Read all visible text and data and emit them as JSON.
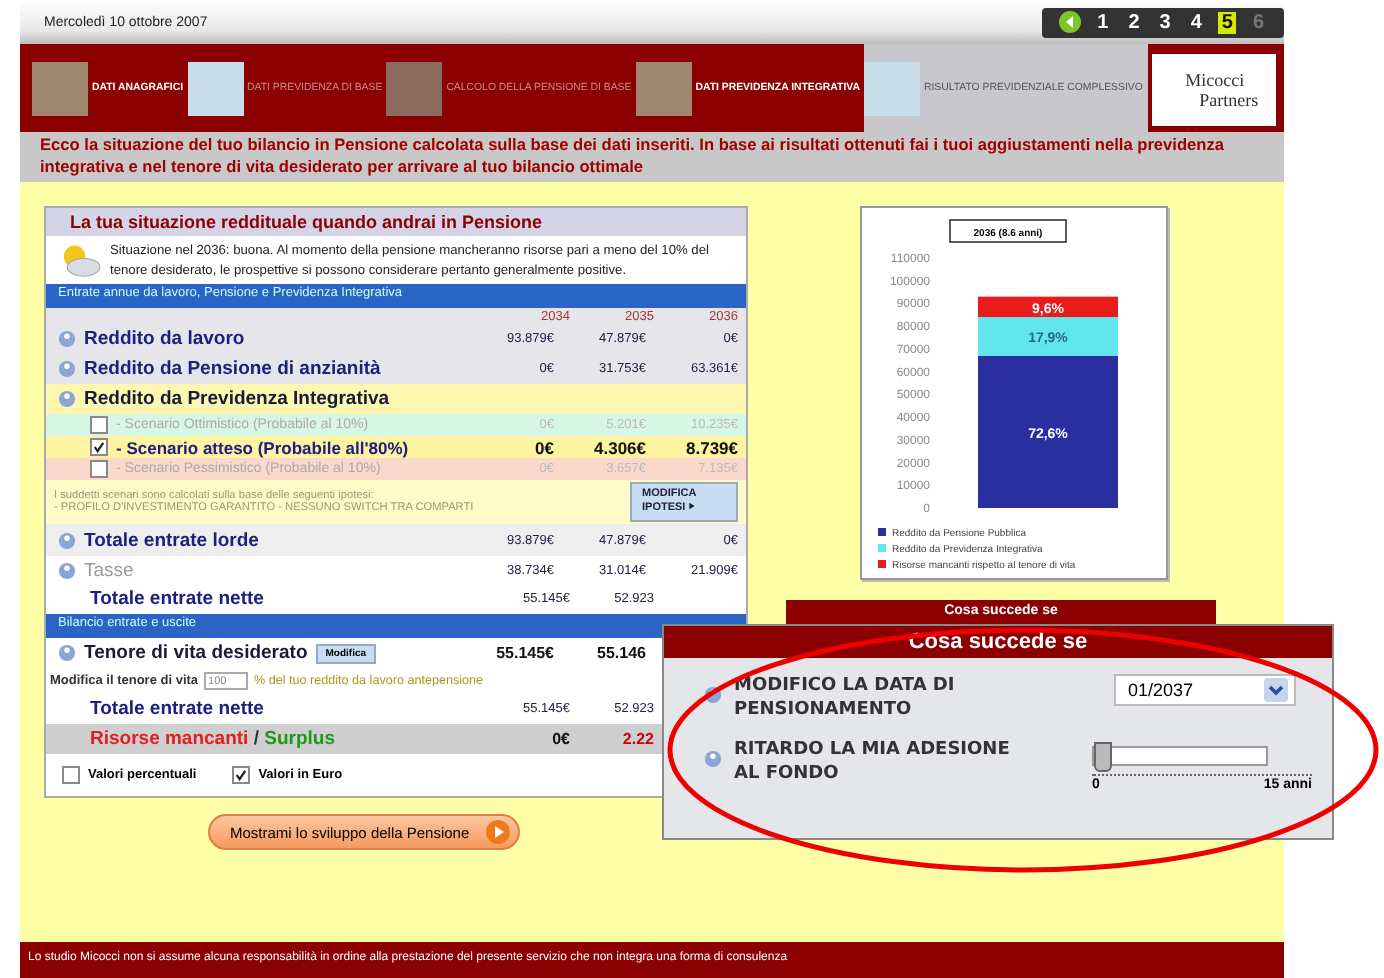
{
  "header": {
    "date": "Mercoledì 10 ottobre 2007",
    "steps": [
      {
        "label": "1",
        "selected": false,
        "disabled": false
      },
      {
        "label": "2",
        "selected": false,
        "disabled": false
      },
      {
        "label": "3",
        "selected": false,
        "disabled": false
      },
      {
        "label": "4",
        "selected": false,
        "disabled": false
      },
      {
        "label": "5",
        "selected": true,
        "disabled": false
      },
      {
        "label": "6",
        "selected": false,
        "disabled": true
      }
    ]
  },
  "tabs": [
    {
      "label": "DATI ANAGRAFICI",
      "selected": false,
      "disabled": false
    },
    {
      "label": "DATI PREVIDENZA DI BASE",
      "selected": false,
      "disabled": true
    },
    {
      "label": "CALCOLO DELLA PENSIONE DI BASE",
      "selected": false,
      "disabled": true
    },
    {
      "label": "DATI PREVIDENZA INTEGRATIVA",
      "selected": false,
      "disabled": false
    },
    {
      "label": "RISULTATO PREVIDENZIALE COMPLESSIVO",
      "selected": true,
      "disabled": false
    }
  ],
  "logo": {
    "line1": "Micocci",
    "line2": "Partners"
  },
  "intro": "Ecco la situazione del tuo bilancio in Pensione calcolata sulla base dei dati inseriti. In base ai risultati ottenuti fai i tuoi aggiustamenti nella previdenza integrativa e nel tenore di vita desiderato per arrivare al tuo bilancio ottimale",
  "panel": {
    "title": "La tua situazione reddituale quando andrai in Pensione",
    "summary": "Situazione nel 2036: buona. Al momento della pensione mancheranno risorse pari a meno del 10% del tenore desiderato, le prospettive si possono considerare pertanto generalmente positive.",
    "section": "Entrate annue da lavoro, Pensione e Previdenza Integrativa",
    "years": [
      "2034",
      "2035",
      "2036"
    ],
    "rows": [
      {
        "kind": "income",
        "label": "Reddito da lavoro",
        "values": [
          "93.879€",
          "47.879€",
          "0€"
        ]
      },
      {
        "kind": "income",
        "label": "Reddito da Pensione di anzianità",
        "values": [
          "0€",
          "31.753€",
          "63.361€"
        ]
      },
      {
        "kind": "group",
        "label": "Reddito da Previdenza Integrativa"
      },
      {
        "kind": "scenario",
        "label": "- Scenario Ottimistico (Probabile al 10%)",
        "checked": false,
        "color": "#d6f7e6",
        "values": [
          "0€",
          "5.201€",
          "10.235€"
        ]
      },
      {
        "kind": "scenario",
        "label": "- Scenario atteso (Probabile all'80%)",
        "checked": true,
        "color": "#fdf3a0",
        "values": [
          "0€",
          "4.306€",
          "8.739€"
        ]
      },
      {
        "kind": "scenario",
        "label": "- Scenario Pessimistico (Probabile al 10%)",
        "checked": false,
        "color": "#fbd8cc",
        "values": [
          "0€",
          "3.657€",
          "7.135€"
        ]
      },
      {
        "kind": "note",
        "lines": [
          "I suddetti scenari sono calcolati sulla base delle seguenti ipotesi:",
          "- PROFILO D'INVESTIMENTO GARANTITO - NESSUNO SWITCH TRA COMPARTI"
        ],
        "button": "MODIFICA IPOTESI"
      },
      {
        "kind": "total",
        "label": "Totale entrate lorde",
        "values": [
          "93.879€",
          "47.879€",
          "0€"
        ]
      },
      {
        "kind": "tax",
        "label": "Tasse",
        "values": [
          "38.734€",
          "31.014€",
          "21.909€"
        ]
      },
      {
        "kind": "subtotal",
        "label": "Totale entrate nette",
        "values": [
          "55.145€",
          "52.923"
        ]
      },
      {
        "kind": "section",
        "label": "Bilancio entrate e uscite"
      },
      {
        "kind": "tenore",
        "label": "Tenore di vita desiderato",
        "button": "Modifica",
        "values": [
          "55.145€",
          "55.146"
        ]
      },
      {
        "kind": "modify",
        "label": "Modifica il tenore di vita",
        "value": "100",
        "suffix": "% del tuo reddito da lavoro antepensione"
      },
      {
        "kind": "subtotal",
        "label": "Totale entrate nette",
        "values": [
          "55.145€",
          "52.923"
        ]
      },
      {
        "kind": "balance",
        "missing": "Risorse mancanti",
        "sep": "/",
        "surplus": "Surplus",
        "values": [
          "0€",
          "2.22"
        ]
      }
    ],
    "options": [
      {
        "label": "Valori percentuali",
        "checked": false
      },
      {
        "label": "Valori in Euro",
        "checked": true
      }
    ]
  },
  "chart_data": {
    "type": "bar",
    "title": "2036 (8.6 anni)",
    "stacked": true,
    "legend": "bottom",
    "ylim": [
      0,
      110000
    ],
    "yticks": [
      0,
      10000,
      20000,
      30000,
      40000,
      50000,
      60000,
      70000,
      80000,
      90000,
      100000,
      110000
    ],
    "series": [
      {
        "name": "Reddito da Pensione Pubblica",
        "color": "#2b2e9e",
        "values": [
          67000
        ]
      },
      {
        "name": "Reddito da Previdenza Integrativa",
        "color": "#62e6ee",
        "values": [
          17000
        ]
      },
      {
        "name": "Risorse mancanti rispetto al tenore di vita",
        "color": "#e81c1c",
        "values": [
          9000
        ]
      }
    ],
    "value_labels": [
      "72,6%",
      "17,9%",
      "9,6%"
    ]
  },
  "show_button": "Mostrami lo sviluppo della Pensione",
  "popup": {
    "tab": "Cosa succede se",
    "title": "Cosa succede se",
    "date_label": "MODIFICO LA DATA DI PENSIONAMENTO",
    "date_value": "01/2037",
    "delay_label": "RITARDO LA MIA ADESIONE AL FONDO",
    "slider": {
      "level": 0,
      "min": "0",
      "max": "15 anni"
    }
  },
  "disclaimer": "Lo studio Micocci non si assume alcuna responsabilità in ordine alla prestazione del presente servizio che non integra una forma di consulenza"
}
